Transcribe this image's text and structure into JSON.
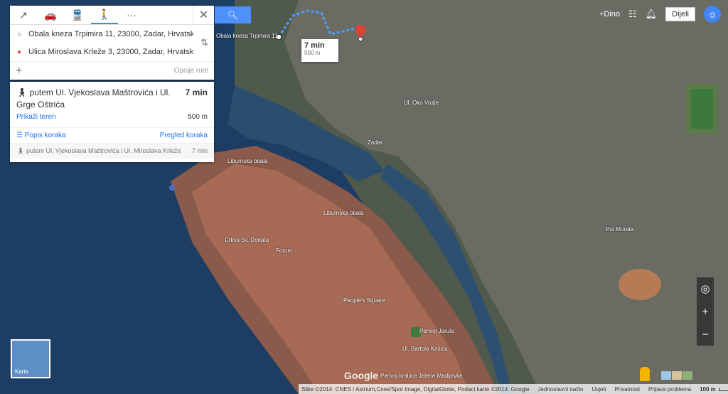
{
  "topbar": {
    "user": "+Dino",
    "share": "Dijeli"
  },
  "directions": {
    "origin": "Obala kneza Trpimira 11, 23000, Zadar, Hrvatska",
    "destination": "Ulica Miroslava Krleže 3, 23000, Zadar, Hrvatska",
    "route_options": "Opcije rute",
    "modes": [
      "route-icon",
      "car-icon",
      "transit-icon",
      "walk-icon",
      "more-icon"
    ]
  },
  "route": {
    "title": "putem Ul. Vjekoslava Maštrovića i Ul. Grge Oštrića",
    "time": "7 min",
    "show_terrain": "Prikaži teren",
    "distance": "500 m",
    "steps_list": "Popis koraka",
    "overview": "Pregled koraka",
    "alt_title": "putem Ul. Vjekoslava Maštrovića i Ul. Miroslava Krleže",
    "alt_time": "7 min"
  },
  "callout": {
    "time": "7 min",
    "distance": "500 m"
  },
  "thumbnail": {
    "label": "Karta"
  },
  "footer": {
    "imagery": "Slike ©2014. CNES / Astrium,Cnes/Spot Image, DigitalGlobe, Podaci karte ©2014. Google",
    "link1": "Jednostavni način",
    "link2": "Uvjeti",
    "link3": "Privatnost",
    "link4": "Prijava problema",
    "scale": "100 m"
  },
  "map_labels": {
    "trpimira": "Obala kneza Trpimira 11",
    "liburnska": "Liburnska obala",
    "liburnska2": "Liburnska obala",
    "donata": "Crkva Sv. Donata",
    "forum": "Forum",
    "peoples": "People's Square",
    "bartola": "Ul. Bartola Kašića",
    "perivoj": "Perivoj Jarula",
    "perivoj2": "Perivoj kraljice Jelene Madijevke",
    "oko_vrulje": "Ul. Oko Vrulje",
    "zadar": "Zadar",
    "punta": "Put Murata",
    "google": "Google"
  },
  "colors": {
    "accent": "#4285f4",
    "route": "#4d9fff",
    "pin": "#db4437"
  }
}
